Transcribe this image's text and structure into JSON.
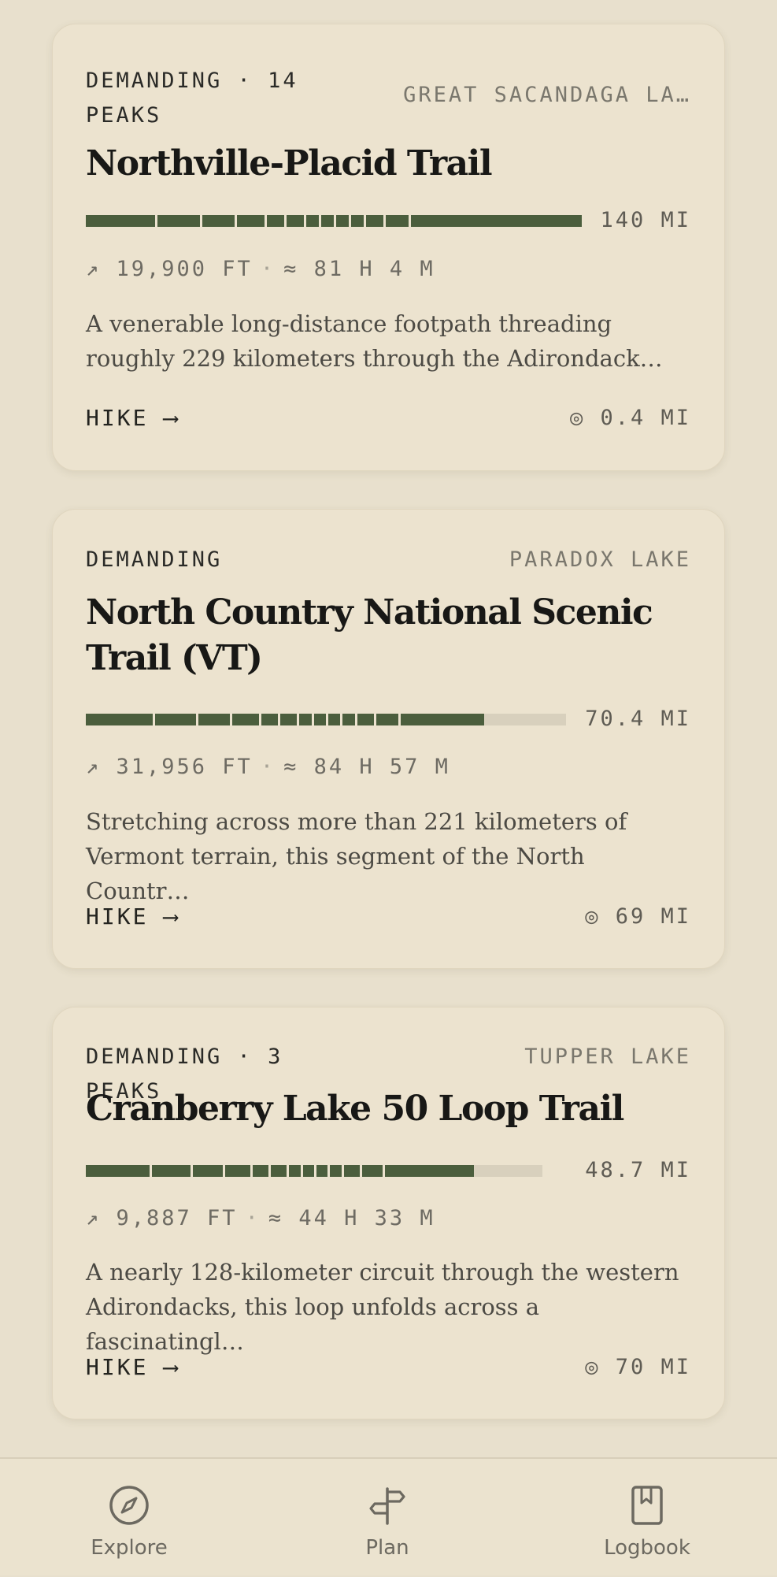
{
  "trails": [
    {
      "difficulty": "DEMANDING · 14 PEAKS",
      "location": "GREAT SACANDAGA LA…",
      "title": "Northville-Placid Trail",
      "progress": 1.0,
      "distance": "140 MI",
      "elevation": "↗ 19,900 FT",
      "duration": "≈ 81 H 4 M",
      "description": "A venerable long-distance footpath threading roughly 229 kilometers through the Adirondack…",
      "action": "HIKE ⟶",
      "nearby": "◎ 0.4 MI"
    },
    {
      "difficulty": "DEMANDING",
      "location": "PARADOX LAKE",
      "title": "North Country National Scenic Trail (VT)",
      "progress": 0.83,
      "distance": "70.4 MI",
      "elevation": "↗ 31,956 FT",
      "duration": "≈ 84 H 57 M",
      "description": "Stretching across more than 221 kilometers of Vermont terrain, this segment of the North Countr…",
      "action": "HIKE ⟶",
      "nearby": "◎ 69 MI"
    },
    {
      "difficulty": "DEMANDING · 3 PEAKS",
      "location": "TUPPER LAKE",
      "title": "Cranberry Lake 50 Loop Trail",
      "progress": 0.85,
      "distance": "48.7 MI",
      "elevation": "↗ 9,887 FT",
      "duration": "≈ 44 H 33 M",
      "description": "A nearly 128-kilometer circuit through the western Adirondacks, this loop unfolds across a fascinatingl…",
      "action": "HIKE ⟶",
      "nearby": "◎ 70 MI"
    }
  ],
  "nav": {
    "explore": "Explore",
    "plan": "Plan",
    "logbook": "Logbook"
  },
  "colors": {
    "background": "#e8e0cd",
    "card": "#ece3cf",
    "accent": "#4b5e3d",
    "track": "#d8d0bd"
  }
}
